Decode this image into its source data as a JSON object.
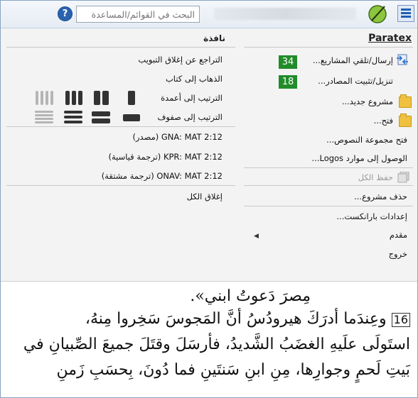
{
  "topbar": {
    "search_placeholder": "البحث في القوائم/المساعدة",
    "help_glyph": "?",
    "icons": [
      "menu-icon",
      "paratext-logo-icon",
      "help-icon"
    ]
  },
  "paratex_menu": {
    "title": "Paratex",
    "items": [
      {
        "label": "إرسال/تلقي المشاريع...",
        "badge": "34"
      },
      {
        "label": "تنزيل/تثبيت المصادر...",
        "badge": "18"
      },
      {
        "label": "مشروع جديد..."
      },
      {
        "label": "فتح..."
      },
      {
        "label": "فتح مجموعة النصوص..."
      },
      {
        "label": "الوصول إلى موارد Logos..."
      },
      {
        "label": "حفظ الكل",
        "disabled": true
      },
      {
        "label": "حذف مشروع..."
      },
      {
        "label": "إعدادات بارانكست..."
      },
      {
        "label": "مقدم",
        "submenu": "◀"
      },
      {
        "label": "خروج"
      }
    ]
  },
  "window_menu": {
    "title": "نافذة",
    "items": [
      {
        "label": "التراجع عن إغلاق التبويب"
      },
      {
        "label": "الذهاب إلى كتاب"
      },
      {
        "label": "الترتيب إلى أعمدة"
      },
      {
        "label": "الترتيب إلى صفوف"
      },
      {
        "label": "GNA: MAT 2:12 (مصدر)"
      },
      {
        "label": "KPR: MAT 2:12 (ترجمة قياسية)"
      },
      {
        "label": "ONAV: MAT 2:12 (ترجمة مشتقة)"
      },
      {
        "label": "إغلاق الكل"
      }
    ]
  },
  "collapse_glyph": "⌃",
  "scripture": {
    "lines": [
      "مِصرَ دَعوتُ ابني».",
      "وعِندَما أدرَكَ هيرودُسُ أنَّ المَجوسَ سَخِروا مِنهُ،",
      "استَولَى علَيهِ الغضَبُ الشَّديدُ، فأرسَلَ وقتَلَ جميعَ الصِّبيانِ في",
      "بَيتِ لَحمٍ وجوارِها، مِنِ ابنِ سَنتَينِ فما دُونَ، بِحسَبِ زَمنِ"
    ],
    "verse_number": "16"
  },
  "colors": {
    "badge_green": "#228b2a",
    "accent_blue": "#1f5fb3",
    "panel_bg": "#f3f3f3"
  }
}
